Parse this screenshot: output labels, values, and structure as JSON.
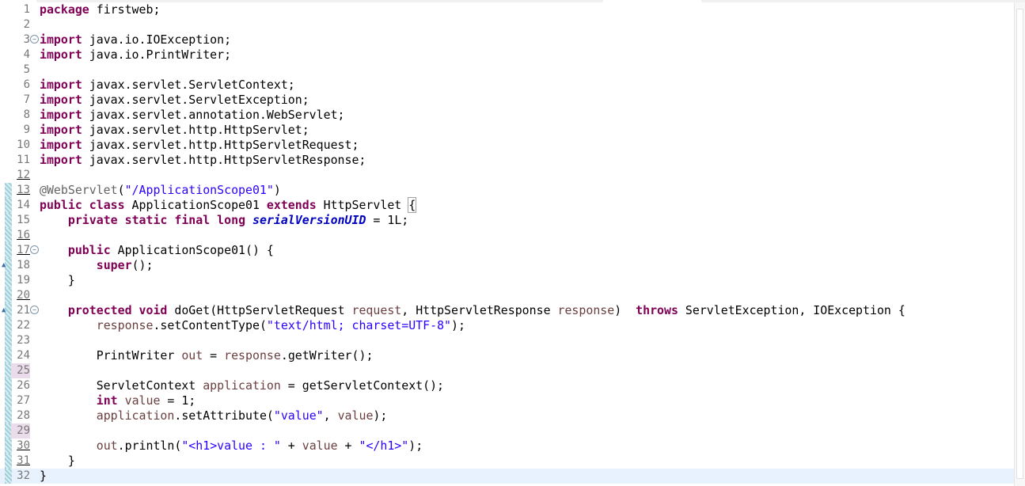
{
  "editor": {
    "lines": [
      {
        "n": "1",
        "tokens": [
          {
            "t": "package",
            "c": "kw"
          },
          {
            "t": " firstweb;"
          }
        ]
      },
      {
        "n": "2",
        "tokens": []
      },
      {
        "n": "3",
        "fold": true,
        "tokens": [
          {
            "t": "import",
            "c": "kw"
          },
          {
            "t": " java.io.IOException;"
          }
        ]
      },
      {
        "n": "4",
        "tokens": [
          {
            "t": "import",
            "c": "kw"
          },
          {
            "t": " java.io.PrintWriter;"
          }
        ]
      },
      {
        "n": "5",
        "tokens": []
      },
      {
        "n": "6",
        "tokens": [
          {
            "t": "import",
            "c": "kw"
          },
          {
            "t": " javax.servlet.ServletContext;"
          }
        ]
      },
      {
        "n": "7",
        "tokens": [
          {
            "t": "import",
            "c": "kw"
          },
          {
            "t": " javax.servlet.ServletException;"
          }
        ]
      },
      {
        "n": "8",
        "tokens": [
          {
            "t": "import",
            "c": "kw"
          },
          {
            "t": " javax.servlet.annotation.WebServlet;"
          }
        ]
      },
      {
        "n": "9",
        "tokens": [
          {
            "t": "import",
            "c": "kw"
          },
          {
            "t": " javax.servlet.http.HttpServlet;"
          }
        ]
      },
      {
        "n": "10",
        "tokens": [
          {
            "t": "import",
            "c": "kw"
          },
          {
            "t": " javax.servlet.http.HttpServletRequest;"
          }
        ]
      },
      {
        "n": "11",
        "tokens": [
          {
            "t": "import",
            "c": "kw"
          },
          {
            "t": " javax.servlet.http.HttpServletResponse;"
          }
        ]
      },
      {
        "n": "12",
        "ul": true,
        "tokens": []
      },
      {
        "n": "13",
        "qd": true,
        "ul": true,
        "tokens": [
          {
            "t": "@WebServlet",
            "c": "ann"
          },
          {
            "t": "("
          },
          {
            "t": "\"/ApplicationScope01\"",
            "c": "str"
          },
          {
            "t": ")"
          }
        ]
      },
      {
        "n": "14",
        "qd": true,
        "tokens": [
          {
            "t": "public",
            "c": "kw"
          },
          {
            "t": " "
          },
          {
            "t": "class",
            "c": "kw"
          },
          {
            "t": " ApplicationScope01 "
          },
          {
            "t": "extends",
            "c": "kw"
          },
          {
            "t": " HttpServlet "
          },
          {
            "t": "{",
            "c": "brace-box"
          }
        ]
      },
      {
        "n": "15",
        "qd": true,
        "tokens": [
          {
            "t": "    "
          },
          {
            "t": "private",
            "c": "kw"
          },
          {
            "t": " "
          },
          {
            "t": "static",
            "c": "kw"
          },
          {
            "t": " "
          },
          {
            "t": "final",
            "c": "kw"
          },
          {
            "t": " "
          },
          {
            "t": "long",
            "c": "kw"
          },
          {
            "t": " "
          },
          {
            "t": "serialVersionUID",
            "c": "fld"
          },
          {
            "t": " = 1L;"
          }
        ]
      },
      {
        "n": "16",
        "qd": true,
        "ul": true,
        "tokens": []
      },
      {
        "n": "17",
        "qd": true,
        "ul": true,
        "fold": true,
        "tokens": [
          {
            "t": "    "
          },
          {
            "t": "public",
            "c": "kw"
          },
          {
            "t": " ApplicationScope01() {"
          }
        ]
      },
      {
        "n": "18",
        "qd": true,
        "ovr": true,
        "tokens": [
          {
            "t": "        "
          },
          {
            "t": "super",
            "c": "kw"
          },
          {
            "t": "();"
          }
        ]
      },
      {
        "n": "19",
        "qd": true,
        "tokens": [
          {
            "t": "    }"
          }
        ]
      },
      {
        "n": "20",
        "qd": true,
        "ul": true,
        "tokens": []
      },
      {
        "n": "21",
        "qd": true,
        "ovr": true,
        "fold": true,
        "tokens": [
          {
            "t": "    "
          },
          {
            "t": "protected",
            "c": "kw"
          },
          {
            "t": " "
          },
          {
            "t": "void",
            "c": "kw"
          },
          {
            "t": " doGet(HttpServletRequest "
          },
          {
            "t": "request",
            "c": "var"
          },
          {
            "t": ", HttpServletResponse "
          },
          {
            "t": "response",
            "c": "var"
          },
          {
            "t": ")  "
          },
          {
            "t": "throws",
            "c": "kw"
          },
          {
            "t": " ServletException, IOException {"
          }
        ]
      },
      {
        "n": "22",
        "qd": true,
        "tokens": [
          {
            "t": "        "
          },
          {
            "t": "response",
            "c": "var"
          },
          {
            "t": ".setContentType("
          },
          {
            "t": "\"text/html; charset=UTF-8\"",
            "c": "str"
          },
          {
            "t": ");"
          }
        ]
      },
      {
        "n": "23",
        "qd": true,
        "tokens": []
      },
      {
        "n": "24",
        "qd": true,
        "tokens": [
          {
            "t": "        PrintWriter "
          },
          {
            "t": "out",
            "c": "var"
          },
          {
            "t": " = "
          },
          {
            "t": "response",
            "c": "var"
          },
          {
            "t": ".getWriter();"
          }
        ]
      },
      {
        "n": "25",
        "qd": true,
        "mark": true,
        "tokens": []
      },
      {
        "n": "26",
        "qd": true,
        "tokens": [
          {
            "t": "        ServletContext "
          },
          {
            "t": "application",
            "c": "var"
          },
          {
            "t": " = getServletContext();"
          }
        ]
      },
      {
        "n": "27",
        "qd": true,
        "tokens": [
          {
            "t": "        "
          },
          {
            "t": "int",
            "c": "kw"
          },
          {
            "t": " "
          },
          {
            "t": "value",
            "c": "var"
          },
          {
            "t": " = 1;"
          }
        ]
      },
      {
        "n": "28",
        "qd": true,
        "tokens": [
          {
            "t": "        "
          },
          {
            "t": "application",
            "c": "var"
          },
          {
            "t": ".setAttribute("
          },
          {
            "t": "\"value\"",
            "c": "str"
          },
          {
            "t": ", "
          },
          {
            "t": "value",
            "c": "var"
          },
          {
            "t": ");"
          }
        ]
      },
      {
        "n": "29",
        "qd": true,
        "mark": true,
        "tokens": []
      },
      {
        "n": "30",
        "qd": true,
        "ul": true,
        "tokens": [
          {
            "t": "        "
          },
          {
            "t": "out",
            "c": "var"
          },
          {
            "t": ".println("
          },
          {
            "t": "\"<h1>value : \"",
            "c": "str"
          },
          {
            "t": " + "
          },
          {
            "t": "value",
            "c": "var"
          },
          {
            "t": " + "
          },
          {
            "t": "\"</h1>\"",
            "c": "str"
          },
          {
            "t": ");"
          }
        ]
      },
      {
        "n": "31",
        "qd": true,
        "ul": true,
        "tokens": [
          {
            "t": "    }"
          }
        ]
      },
      {
        "n": "32",
        "qd": true,
        "current": true,
        "tokens": [
          {
            "t": "}"
          }
        ]
      }
    ]
  }
}
